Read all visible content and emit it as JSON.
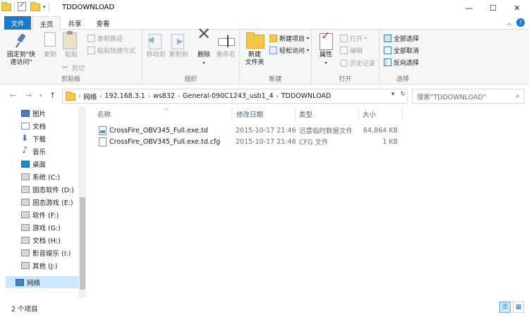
{
  "window": {
    "title": "TDDOWNLOAD",
    "buttons": [
      "—",
      "☐",
      "✕"
    ]
  },
  "qat": {
    "dropdown": "▾"
  },
  "tabs": [
    "文件",
    "主页",
    "共享",
    "查看"
  ],
  "ribbon": {
    "clipboard": {
      "label": "剪贴板",
      "pin": "固定到\"快\n速访问\"",
      "copy": "复制",
      "paste": "粘贴",
      "copy_path": "复制路径",
      "paste_shortcut": "粘贴快捷方式",
      "cut": "剪切"
    },
    "organize": {
      "label": "组织",
      "move_to": "移动到",
      "copy_to": "复制到",
      "delete": "删除",
      "rename": "重命名"
    },
    "new": {
      "label": "新建",
      "new_folder": "新建\n文件夹",
      "new_item": "新建项目",
      "easy_access": "轻松访问"
    },
    "open": {
      "label": "打开",
      "properties": "属性",
      "open": "打开",
      "edit": "编辑",
      "history": "历史记录"
    },
    "select": {
      "label": "选择",
      "select_all": "全部选择",
      "select_none": "全部取消",
      "invert": "反向选择"
    }
  },
  "address": {
    "crumbs": [
      "网络",
      "192.168.3.1",
      "ws832",
      "General-090C1243_usb1_4",
      "TDDOWNLOAD"
    ],
    "search_placeholder": "搜索\"TDDOWNLOAD\""
  },
  "navpane": {
    "items": [
      {
        "label": "图片",
        "icon": "pictures-icon"
      },
      {
        "label": "文档",
        "icon": "documents-icon"
      },
      {
        "label": "下载",
        "icon": "downloads-icon"
      },
      {
        "label": "音乐",
        "icon": "music-icon"
      },
      {
        "label": "桌面",
        "icon": "desktop-icon"
      },
      {
        "label": "系统 (C:)",
        "icon": "drive-icon"
      },
      {
        "label": "固态软件 (D:)",
        "icon": "drive-icon"
      },
      {
        "label": "固态游戏 (E:)",
        "icon": "drive-icon"
      },
      {
        "label": "软件 (F:)",
        "icon": "drive-icon"
      },
      {
        "label": "游戏 (G:)",
        "icon": "drive-icon"
      },
      {
        "label": "文档 (H:)",
        "icon": "drive-icon"
      },
      {
        "label": "影音娱乐 (I:)",
        "icon": "drive-icon"
      },
      {
        "label": "其他 (J:)",
        "icon": "drive-icon"
      }
    ],
    "network": "网络"
  },
  "columns": [
    "名称",
    "修改日期",
    "类型",
    "大小"
  ],
  "files": [
    {
      "name": "CrossFire_OBV345_Full.exe.td",
      "date": "2015-10-17 21:46",
      "type": "迅雷临时数据文件",
      "size": "64,864 KB"
    },
    {
      "name": "CrossFire_OBV345_Full.exe.td.cfg",
      "date": "2015-10-17 21:46",
      "type": "CFG 文件",
      "size": "1 KB"
    }
  ],
  "status": {
    "count": "2 个项目"
  }
}
